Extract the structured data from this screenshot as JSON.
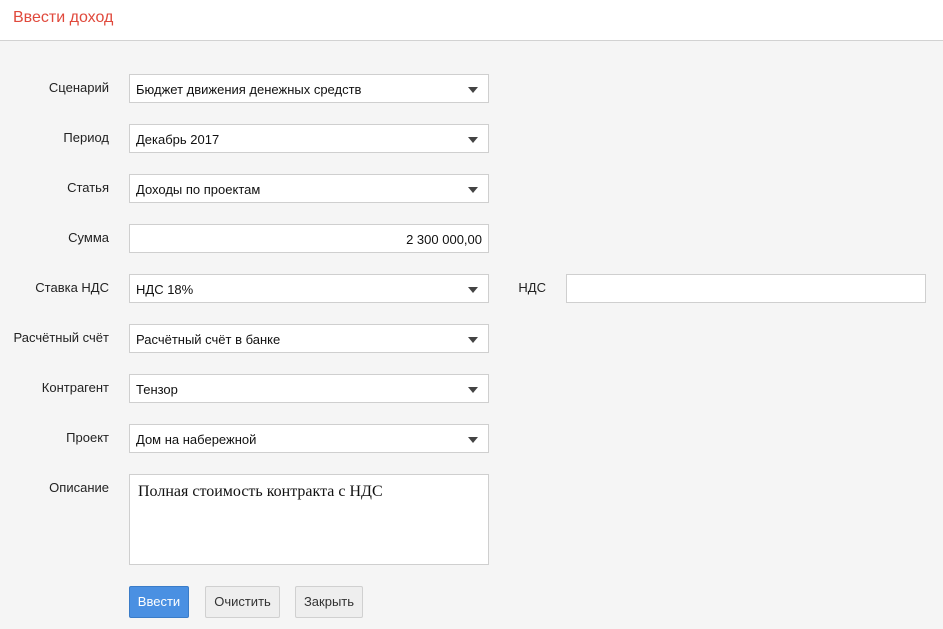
{
  "header": {
    "title": "Ввести доход"
  },
  "form": {
    "scenario": {
      "label": "Сценарий",
      "value": "Бюджет движения денежных средств"
    },
    "period": {
      "label": "Период",
      "value": "Декабрь 2017"
    },
    "article": {
      "label": "Статья",
      "value": "Доходы по проектам"
    },
    "amount": {
      "label": "Сумма",
      "value": "2 300 000,00"
    },
    "vat_rate": {
      "label": "Ставка НДС",
      "value": "НДС 18%"
    },
    "vat": {
      "label": "НДС",
      "value": ""
    },
    "account": {
      "label": "Расчётный счёт",
      "value": "Расчётный счёт в банке"
    },
    "counterparty": {
      "label": "Контрагент",
      "value": "Тензор"
    },
    "project": {
      "label": "Проект",
      "value": "Дом на набережной"
    },
    "description": {
      "label": "Описание",
      "value": "Полная стоимость контракта с НДС"
    }
  },
  "buttons": {
    "submit": "Ввести",
    "clear": "Очистить",
    "close": "Закрыть"
  },
  "colors": {
    "title": "#e0493c",
    "primary": "#4a90e2",
    "background": "#f5f5f5"
  }
}
